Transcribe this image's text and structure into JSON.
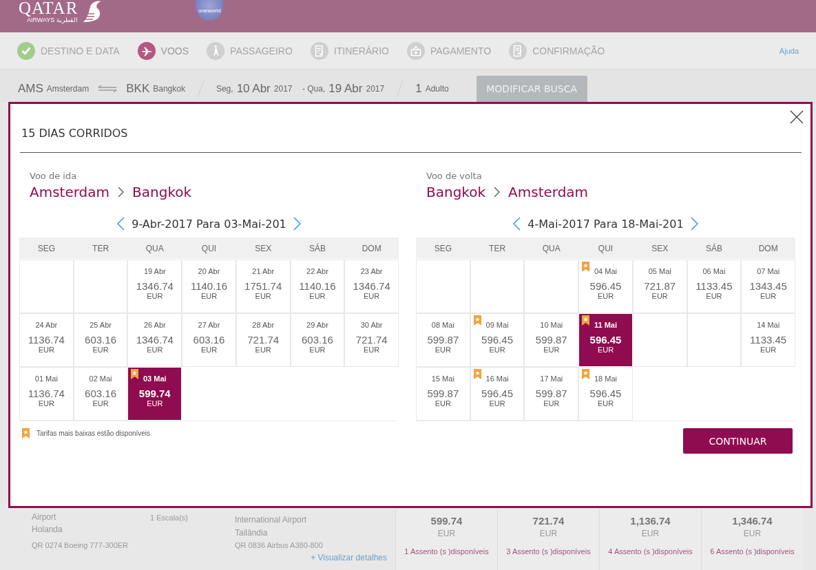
{
  "header": {
    "logo": {
      "word": "QATAR",
      "sub": "AIRWAYS",
      "arabic": "القطرية"
    },
    "alliance": "oneworld"
  },
  "steps": [
    {
      "label": "DESTINO E DATA",
      "done": true,
      "selected": false
    },
    {
      "label": "VOOS",
      "done": false,
      "selected": true
    },
    {
      "label": "PASSAGEIRO",
      "done": false,
      "selected": false
    },
    {
      "label": "ITINERÁRIO",
      "done": false,
      "selected": false
    },
    {
      "label": "PAGAMENTO",
      "done": false,
      "selected": false
    },
    {
      "label": "CONFIRMAÇÃO",
      "done": false,
      "selected": false
    }
  ],
  "help_link": "Ajuda",
  "search_summary": {
    "origin_code": "AMS",
    "origin_city": "Amsterdam",
    "destination_code": "BKK",
    "destination_city": "Bangkok",
    "depart_weekday": "Seg,",
    "depart_date": "10 Abr",
    "depart_year": "2017",
    "return_weekday": "- Qua,",
    "return_date": "19 Abr",
    "return_year": "2017",
    "passenger_count": "1",
    "passenger_type": "Adulto",
    "modify_button": "MODIFICAR BUSCA"
  },
  "results": {
    "origin_lines": [
      "Airport",
      "Holanda"
    ],
    "origin_flight": "QR 0274 Boeing 777-300ER",
    "stops": "1 Escala(s)",
    "destination_lines": [
      "International Airport",
      "Tailândia"
    ],
    "destination_flight": "QR 0836 Airbus A380-800",
    "details_link": "+ Visualizar detalhes",
    "fares": [
      {
        "price": "599.74",
        "currency": "EUR",
        "seats": "1 Assento (s )disponíveis"
      },
      {
        "price": "721.74",
        "currency": "EUR",
        "seats": "3 Assento (s )disponíveis"
      },
      {
        "price": "1,136.74",
        "currency": "EUR",
        "seats": "4 Assento (s )disponíveis"
      },
      {
        "price": "1,346.74",
        "currency": "EUR",
        "seats": "6 Assento (s )disponíveis"
      }
    ]
  },
  "modal": {
    "title": "15 DIAS CORRIDOS",
    "legend": "Tarifas mais baixas estão disponíveis",
    "continue_button": "CONTINUAR",
    "calendars": [
      {
        "label": "Voo de ida",
        "origin": "Amsterdam",
        "destination": "Bangkok",
        "range": "9-Abr-2017 Para 03-Mai-201",
        "weekdays": [
          "SEG",
          "TER",
          "QUA",
          "QUI",
          "SEX",
          "SÁB",
          "DOM"
        ],
        "weeks": [
          [
            {
              "kind": "empty"
            },
            {
              "kind": "empty"
            },
            {
              "kind": "fare",
              "date": "19 Abr",
              "price": "1346.74",
              "currency": "EUR",
              "selected": false,
              "lowest": false
            },
            {
              "kind": "fare",
              "date": "20 Abr",
              "price": "1140.16",
              "currency": "EUR",
              "selected": false,
              "lowest": false
            },
            {
              "kind": "fare",
              "date": "21 Abr",
              "price": "1751.74",
              "currency": "EUR",
              "selected": false,
              "lowest": false
            },
            {
              "kind": "fare",
              "date": "22 Abr",
              "price": "1140.16",
              "currency": "EUR",
              "selected": false,
              "lowest": false
            },
            {
              "kind": "fare",
              "date": "23 Abr",
              "price": "1346.74",
              "currency": "EUR",
              "selected": false,
              "lowest": false
            }
          ],
          [
            {
              "kind": "fare",
              "date": "24 Abr",
              "price": "1136.74",
              "currency": "EUR",
              "selected": false,
              "lowest": false
            },
            {
              "kind": "fare",
              "date": "25 Abr",
              "price": "603.16",
              "currency": "EUR",
              "selected": false,
              "lowest": false
            },
            {
              "kind": "fare",
              "date": "26 Abr",
              "price": "1346.74",
              "currency": "EUR",
              "selected": false,
              "lowest": false
            },
            {
              "kind": "fare",
              "date": "27 Abr",
              "price": "603.16",
              "currency": "EUR",
              "selected": false,
              "lowest": false
            },
            {
              "kind": "fare",
              "date": "28 Abr",
              "price": "721.74",
              "currency": "EUR",
              "selected": false,
              "lowest": false
            },
            {
              "kind": "fare",
              "date": "29 Abr",
              "price": "603.16",
              "currency": "EUR",
              "selected": false,
              "lowest": false
            },
            {
              "kind": "fare",
              "date": "30 Abr",
              "price": "721.74",
              "currency": "EUR",
              "selected": false,
              "lowest": false
            }
          ],
          [
            {
              "kind": "fare",
              "date": "01 Mai",
              "price": "1136.74",
              "currency": "EUR",
              "selected": false,
              "lowest": false
            },
            {
              "kind": "fare",
              "date": "02 Mai",
              "price": "603.16",
              "currency": "EUR",
              "selected": false,
              "lowest": false
            },
            {
              "kind": "fare",
              "date": "03 Mai",
              "price": "599.74",
              "currency": "EUR",
              "selected": true,
              "lowest": true
            }
          ]
        ]
      },
      {
        "label": "Voo de volta",
        "origin": "Bangkok",
        "destination": "Amsterdam",
        "range": "4-Mai-2017 Para 18-Mai-201",
        "weekdays": [
          "SEG",
          "TER",
          "QUA",
          "QUI",
          "SEX",
          "SÁB",
          "DOM"
        ],
        "weeks": [
          [
            {
              "kind": "empty"
            },
            {
              "kind": "empty"
            },
            {
              "kind": "empty"
            },
            {
              "kind": "fare",
              "date": "04 Mai",
              "price": "596.45",
              "currency": "EUR",
              "selected": false,
              "lowest": true
            },
            {
              "kind": "fare",
              "date": "05 Mai",
              "price": "721.87",
              "currency": "EUR",
              "selected": false,
              "lowest": false
            },
            {
              "kind": "fare",
              "date": "06 Mai",
              "price": "1133.45",
              "currency": "EUR",
              "selected": false,
              "lowest": false
            },
            {
              "kind": "fare",
              "date": "07 Mai",
              "price": "1343.45",
              "currency": "EUR",
              "selected": false,
              "lowest": false
            }
          ],
          [
            {
              "kind": "fare",
              "date": "08 Mai",
              "price": "599.87",
              "currency": "EUR",
              "selected": false,
              "lowest": false
            },
            {
              "kind": "fare",
              "date": "09 Mai",
              "price": "596.45",
              "currency": "EUR",
              "selected": false,
              "lowest": true
            },
            {
              "kind": "fare",
              "date": "10 Mai",
              "price": "599.87",
              "currency": "EUR",
              "selected": false,
              "lowest": false
            },
            {
              "kind": "fare",
              "date": "11 Mai",
              "price": "596.45",
              "currency": "EUR",
              "selected": true,
              "lowest": true
            },
            {
              "kind": "empty"
            },
            {
              "kind": "empty"
            },
            {
              "kind": "fare",
              "date": "14 Mai",
              "price": "1133.45",
              "currency": "EUR",
              "selected": false,
              "lowest": false
            }
          ],
          [
            {
              "kind": "fare",
              "date": "15 Mai",
              "price": "599.87",
              "currency": "EUR",
              "selected": false,
              "lowest": false
            },
            {
              "kind": "fare",
              "date": "16 Mai",
              "price": "596.45",
              "currency": "EUR",
              "selected": false,
              "lowest": true
            },
            {
              "kind": "fare",
              "date": "17 Mai",
              "price": "599.87",
              "currency": "EUR",
              "selected": false,
              "lowest": false
            },
            {
              "kind": "fare",
              "date": "18 Mai",
              "price": "596.45",
              "currency": "EUR",
              "selected": false,
              "lowest": true
            }
          ]
        ]
      }
    ]
  }
}
